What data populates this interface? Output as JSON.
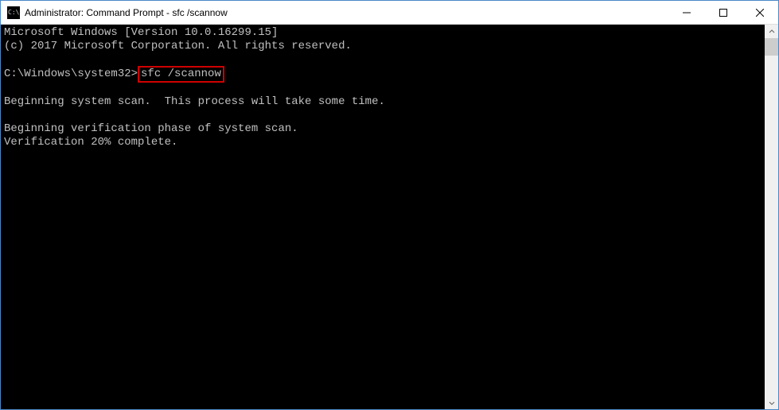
{
  "window": {
    "title": "Administrator: Command Prompt - sfc  /scannow"
  },
  "console": {
    "line1": "Microsoft Windows [Version 10.0.16299.15]",
    "line2": "(c) 2017 Microsoft Corporation. All rights reserved.",
    "blank1": "",
    "prompt": "C:\\Windows\\system32>",
    "command": "sfc /scannow",
    "blank2": "",
    "line3": "Beginning system scan.  This process will take some time.",
    "blank3": "",
    "line4": "Beginning verification phase of system scan.",
    "line5": "Verification 20% complete."
  }
}
